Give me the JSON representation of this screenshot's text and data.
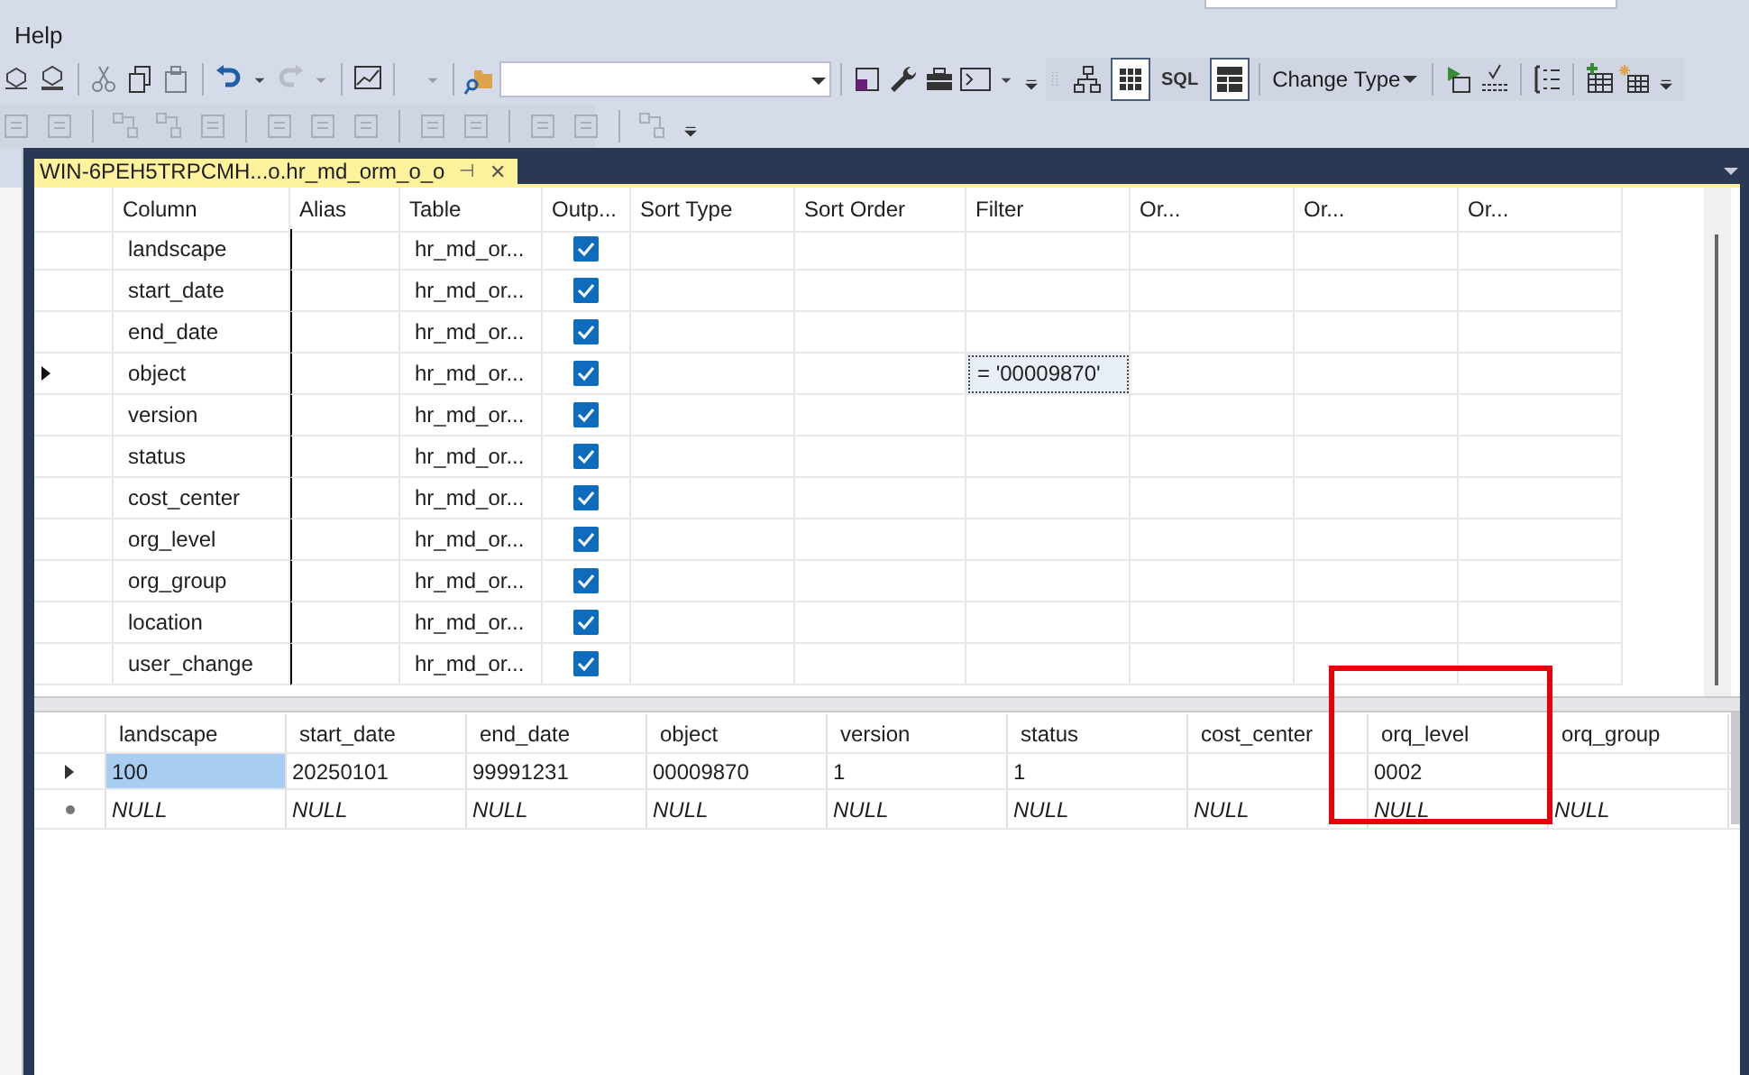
{
  "menu": [
    "Help"
  ],
  "toolbar": {
    "change_type": "Change Type",
    "panes": [
      {
        "kind": "diagram",
        "selected": false
      },
      {
        "kind": "criteria",
        "selected": true
      },
      {
        "kind": "sql",
        "label": "SQL",
        "selected": false
      },
      {
        "kind": "results",
        "selected": true
      }
    ]
  },
  "document_tab": {
    "title": "WIN-6PEH5TRPCMH...o.hr_md_orm_o_o",
    "pin": "⊣",
    "close": "✕"
  },
  "criteria": {
    "columns": [
      "Column",
      "Alias",
      "Table",
      "Outp...",
      "Sort Type",
      "Sort Order",
      "Filter",
      "Or...",
      "Or...",
      "Or..."
    ],
    "rows": [
      {
        "column": "landscape",
        "table": "hr_md_or...",
        "output": true,
        "filter": "",
        "current": false
      },
      {
        "column": "start_date",
        "table": "hr_md_or...",
        "output": true,
        "filter": "",
        "current": false
      },
      {
        "column": "end_date",
        "table": "hr_md_or...",
        "output": true,
        "filter": "",
        "current": false
      },
      {
        "column": "object",
        "table": "hr_md_or...",
        "output": true,
        "filter": "= '00009870'",
        "current": true
      },
      {
        "column": "version",
        "table": "hr_md_or...",
        "output": true,
        "filter": "",
        "current": false
      },
      {
        "column": "status",
        "table": "hr_md_or...",
        "output": true,
        "filter": "",
        "current": false
      },
      {
        "column": "cost_center",
        "table": "hr_md_or...",
        "output": true,
        "filter": "",
        "current": false
      },
      {
        "column": "org_level",
        "table": "hr_md_or...",
        "output": true,
        "filter": "",
        "current": false
      },
      {
        "column": "org_group",
        "table": "hr_md_or...",
        "output": true,
        "filter": "",
        "current": false
      },
      {
        "column": "location",
        "table": "hr_md_or...",
        "output": true,
        "filter": "",
        "current": false
      },
      {
        "column": "user_change",
        "table": "hr_md_or...",
        "output": true,
        "filter": "",
        "current": false
      }
    ]
  },
  "results": {
    "columns": [
      "landscape",
      "start_date",
      "end_date",
      "object",
      "version",
      "status",
      "cost_center",
      "orq_level",
      "orq_group"
    ],
    "rows": [
      {
        "kind": "current",
        "cells": [
          {
            "text": "100",
            "selected": true
          },
          {
            "text": "20250101",
            "selected": false
          },
          {
            "text": "99991231",
            "selected": false
          },
          {
            "text": "00009870",
            "selected": false
          },
          {
            "text": "1",
            "selected": false
          },
          {
            "text": "1",
            "selected": false
          },
          {
            "text": "",
            "selected": false
          },
          {
            "text": "0002",
            "selected": false
          },
          {
            "text": "",
            "selected": false
          }
        ]
      },
      {
        "kind": "new",
        "cells": [
          {
            "text": "NULL",
            "selected": false
          },
          {
            "text": "NULL",
            "selected": false
          },
          {
            "text": "NULL",
            "selected": false
          },
          {
            "text": "NULL",
            "selected": false
          },
          {
            "text": "NULL",
            "selected": false
          },
          {
            "text": "NULL",
            "selected": false
          },
          {
            "text": "NULL",
            "selected": false
          },
          {
            "text": "NULL",
            "selected": false
          },
          {
            "text": "NULL",
            "selected": false
          }
        ]
      }
    ],
    "highlight": {
      "kind": "rectangle"
    }
  }
}
